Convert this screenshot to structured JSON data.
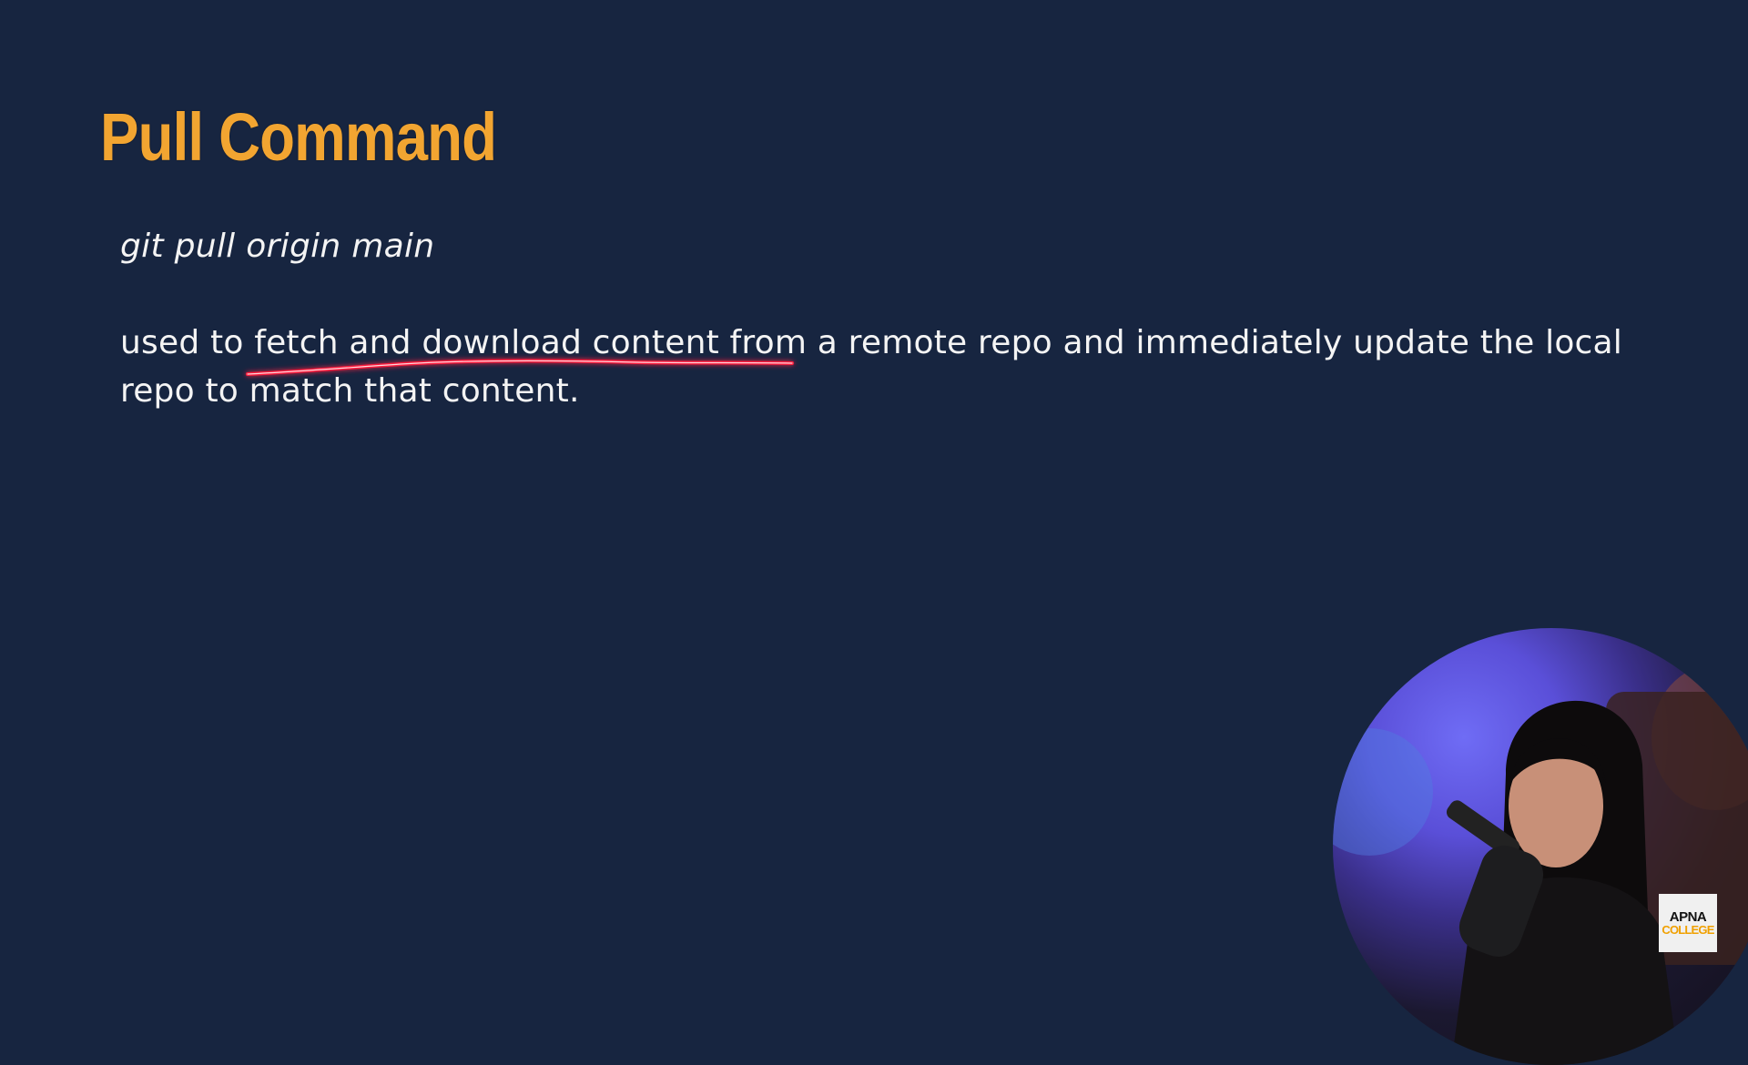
{
  "slide": {
    "title": "Pull Command",
    "command": "git pull origin main",
    "description": "used to fetch and download content from a remote repo and immediately update the local repo to match that content."
  },
  "colors": {
    "background": "#172540",
    "title": "#f2a531",
    "body_text": "#f4f4f4",
    "annotation": "#ff1f3d"
  },
  "annotation": {
    "type": "underline",
    "target_text": "fetch and download content from a"
  },
  "logo": {
    "line1": "APNA",
    "line2": "COLLEGE"
  },
  "webcam": {
    "icon": "presenter-video-icon"
  }
}
